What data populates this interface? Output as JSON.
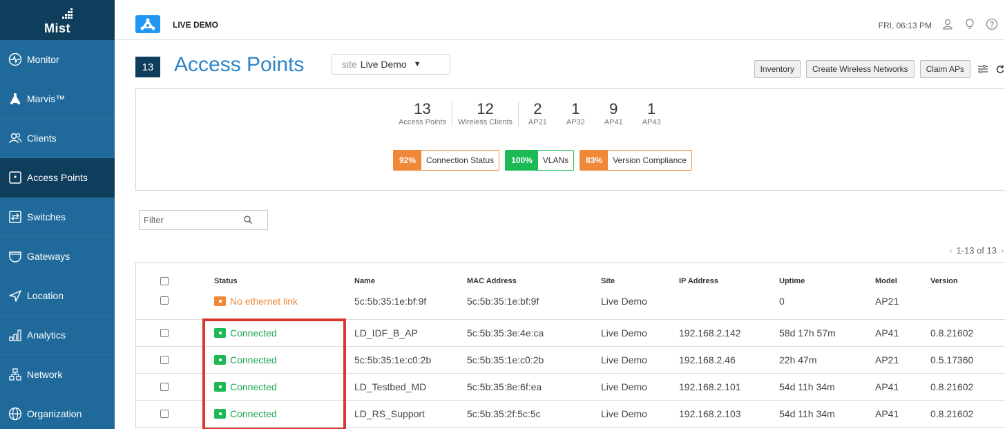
{
  "brand": {
    "name": "Mist"
  },
  "sidebar": {
    "items": [
      {
        "label": "Monitor",
        "icon": "pulse-icon"
      },
      {
        "label": "Marvis™",
        "icon": "marvis-icon"
      },
      {
        "label": "Clients",
        "icon": "users-icon"
      },
      {
        "label": "Access Points",
        "icon": "access-point-icon"
      },
      {
        "label": "Switches",
        "icon": "switch-icon"
      },
      {
        "label": "Gateways",
        "icon": "gateway-icon"
      },
      {
        "label": "Location",
        "icon": "location-icon"
      },
      {
        "label": "Analytics",
        "icon": "analytics-icon"
      },
      {
        "label": "Network",
        "icon": "network-icon"
      },
      {
        "label": "Organization",
        "icon": "globe-icon"
      }
    ]
  },
  "topbar": {
    "site_name": "LIVE DEMO",
    "time": "FRI, 06:13 PM"
  },
  "header": {
    "count": "13",
    "title": "Access Points",
    "site_prefix": "site",
    "site_value": "Live Demo",
    "buttons": {
      "inventory": "Inventory",
      "create": "Create Wireless Networks",
      "claim": "Claim APs"
    }
  },
  "stats": {
    "items": [
      {
        "num": "13",
        "label": "Access Points"
      },
      {
        "num": "12",
        "label": "Wireless Clients"
      },
      {
        "num": "2",
        "label": "AP21"
      },
      {
        "num": "1",
        "label": "AP32"
      },
      {
        "num": "9",
        "label": "AP41"
      },
      {
        "num": "1",
        "label": "AP43"
      }
    ],
    "sle": [
      {
        "pct": "92%",
        "name": "Connection Status",
        "color": "#f0883a"
      },
      {
        "pct": "100%",
        "name": "VLANs",
        "color": "#1db954"
      },
      {
        "pct": "83%",
        "name": "Version Compliance",
        "color": "#f0883a"
      }
    ]
  },
  "filter": {
    "placeholder": "Filter"
  },
  "pager": {
    "text": "1-13 of 13"
  },
  "table": {
    "columns": [
      "Status",
      "Name",
      "MAC Address",
      "Site",
      "IP Address",
      "Uptime",
      "Model",
      "Version"
    ],
    "rows": [
      {
        "status": "No ethernet link",
        "status_kind": "warning",
        "name": "5c:5b:35:1e:bf:9f",
        "mac": "5c:5b:35:1e:bf:9f",
        "site": "Live Demo",
        "ip": "",
        "uptime": "0",
        "model": "AP21",
        "version": ""
      },
      {
        "status": "Connected",
        "status_kind": "ok",
        "name": "LD_IDF_B_AP",
        "mac": "5c:5b:35:3e:4e:ca",
        "site": "Live Demo",
        "ip": "192.168.2.142",
        "uptime": "58d 17h 57m",
        "model": "AP41",
        "version": "0.8.21602"
      },
      {
        "status": "Connected",
        "status_kind": "ok",
        "name": "5c:5b:35:1e:c0:2b",
        "mac": "5c:5b:35:1e:c0:2b",
        "site": "Live Demo",
        "ip": "192.168.2.46",
        "uptime": "22h 47m",
        "model": "AP21",
        "version": "0.5.17360"
      },
      {
        "status": "Connected",
        "status_kind": "ok",
        "name": "LD_Testbed_MD",
        "mac": "5c:5b:35:8e:6f:ea",
        "site": "Live Demo",
        "ip": "192.168.2.101",
        "uptime": "54d 11h 34m",
        "model": "AP41",
        "version": "0.8.21602"
      },
      {
        "status": "Connected",
        "status_kind": "ok",
        "name": "LD_RS_Support",
        "mac": "5c:5b:35:2f:5c:5c",
        "site": "Live Demo",
        "ip": "192.168.2.103",
        "uptime": "54d 11h 34m",
        "model": "AP41",
        "version": "0.8.21602"
      }
    ]
  },
  "colors": {
    "sidebar": "#1f6a9a",
    "sidebar_dark": "#0f3d5c",
    "accent": "#2d84c6",
    "ok": "#1aa64e",
    "warning": "#f0883a",
    "highlight": "#d63a2f"
  }
}
